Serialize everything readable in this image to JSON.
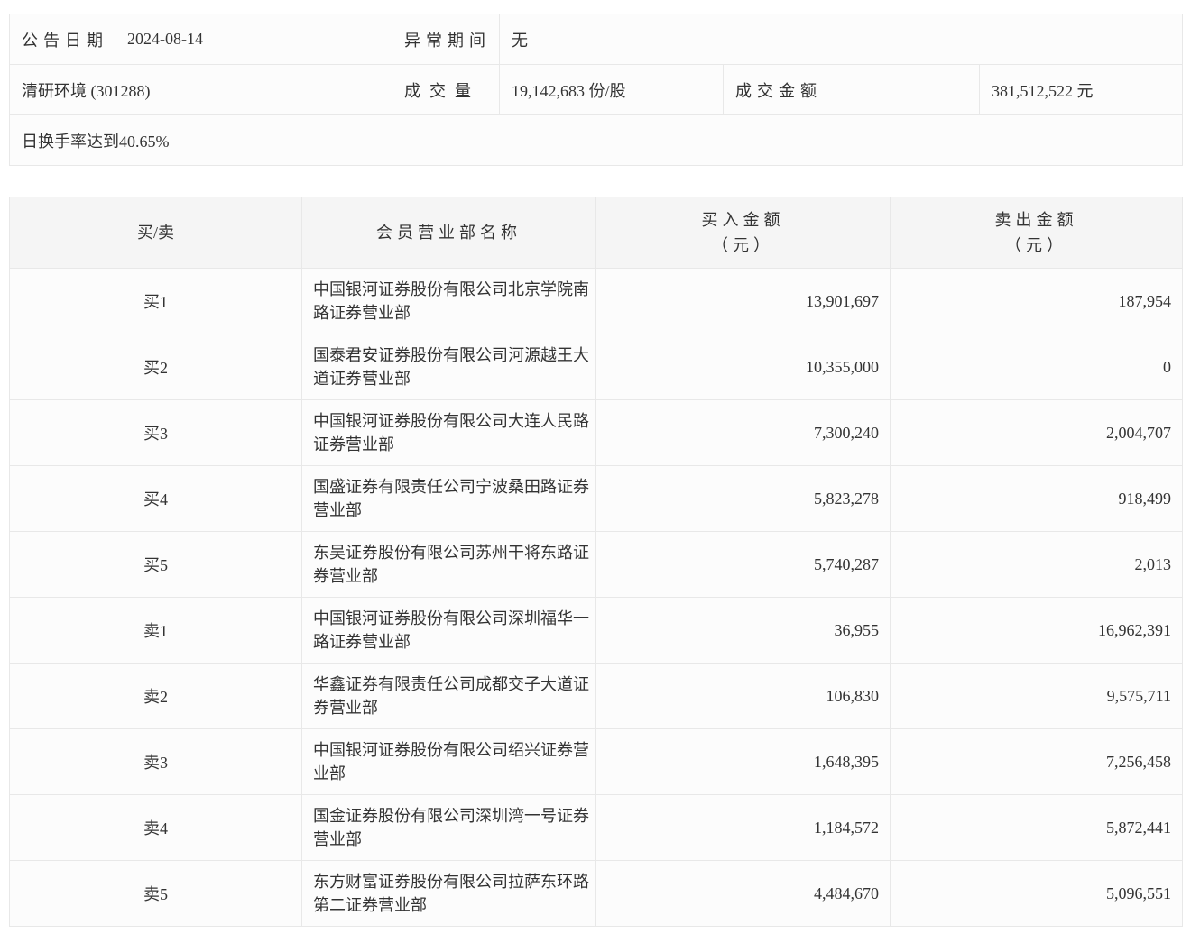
{
  "summary": {
    "announce_date_label": "公告日期",
    "announce_date": "2024-08-14",
    "abnormal_period_label": "异常期间",
    "abnormal_period": "无",
    "stock_name": "清研环境 (301288)",
    "volume_label": "成交量",
    "volume": "19,142,683 份/股",
    "turnover_label": "成交金额",
    "turnover": "381,512,522 元",
    "note": "日换手率达到40.65%"
  },
  "table": {
    "headers": {
      "side": "买/卖",
      "broker": "会员营业部名称",
      "buy_line1": "买入金额",
      "buy_line2": "（元）",
      "sell_line1": "卖出金额",
      "sell_line2": "（元）"
    },
    "rows": [
      {
        "side": "买1",
        "broker": "中国银河证券股份有限公司北京学院南路证券营业部",
        "buy": "13,901,697",
        "sell": "187,954"
      },
      {
        "side": "买2",
        "broker": "国泰君安证券股份有限公司河源越王大道证券营业部",
        "buy": "10,355,000",
        "sell": "0"
      },
      {
        "side": "买3",
        "broker": "中国银河证券股份有限公司大连人民路证券营业部",
        "buy": "7,300,240",
        "sell": "2,004,707"
      },
      {
        "side": "买4",
        "broker": "国盛证券有限责任公司宁波桑田路证券营业部",
        "buy": "5,823,278",
        "sell": "918,499"
      },
      {
        "side": "买5",
        "broker": "东吴证券股份有限公司苏州干将东路证券营业部",
        "buy": "5,740,287",
        "sell": "2,013"
      },
      {
        "side": "卖1",
        "broker": "中国银河证券股份有限公司深圳福华一路证券营业部",
        "buy": "36,955",
        "sell": "16,962,391"
      },
      {
        "side": "卖2",
        "broker": "华鑫证券有限责任公司成都交子大道证券营业部",
        "buy": "106,830",
        "sell": "9,575,711"
      },
      {
        "side": "卖3",
        "broker": "中国银河证券股份有限公司绍兴证券营业部",
        "buy": "1,648,395",
        "sell": "7,256,458"
      },
      {
        "side": "卖4",
        "broker": "国金证券股份有限公司深圳湾一号证券营业部",
        "buy": "1,184,572",
        "sell": "5,872,441"
      },
      {
        "side": "卖5",
        "broker": "东方财富证券股份有限公司拉萨东环路第二证券营业部",
        "buy": "4,484,670",
        "sell": "5,096,551"
      }
    ]
  }
}
